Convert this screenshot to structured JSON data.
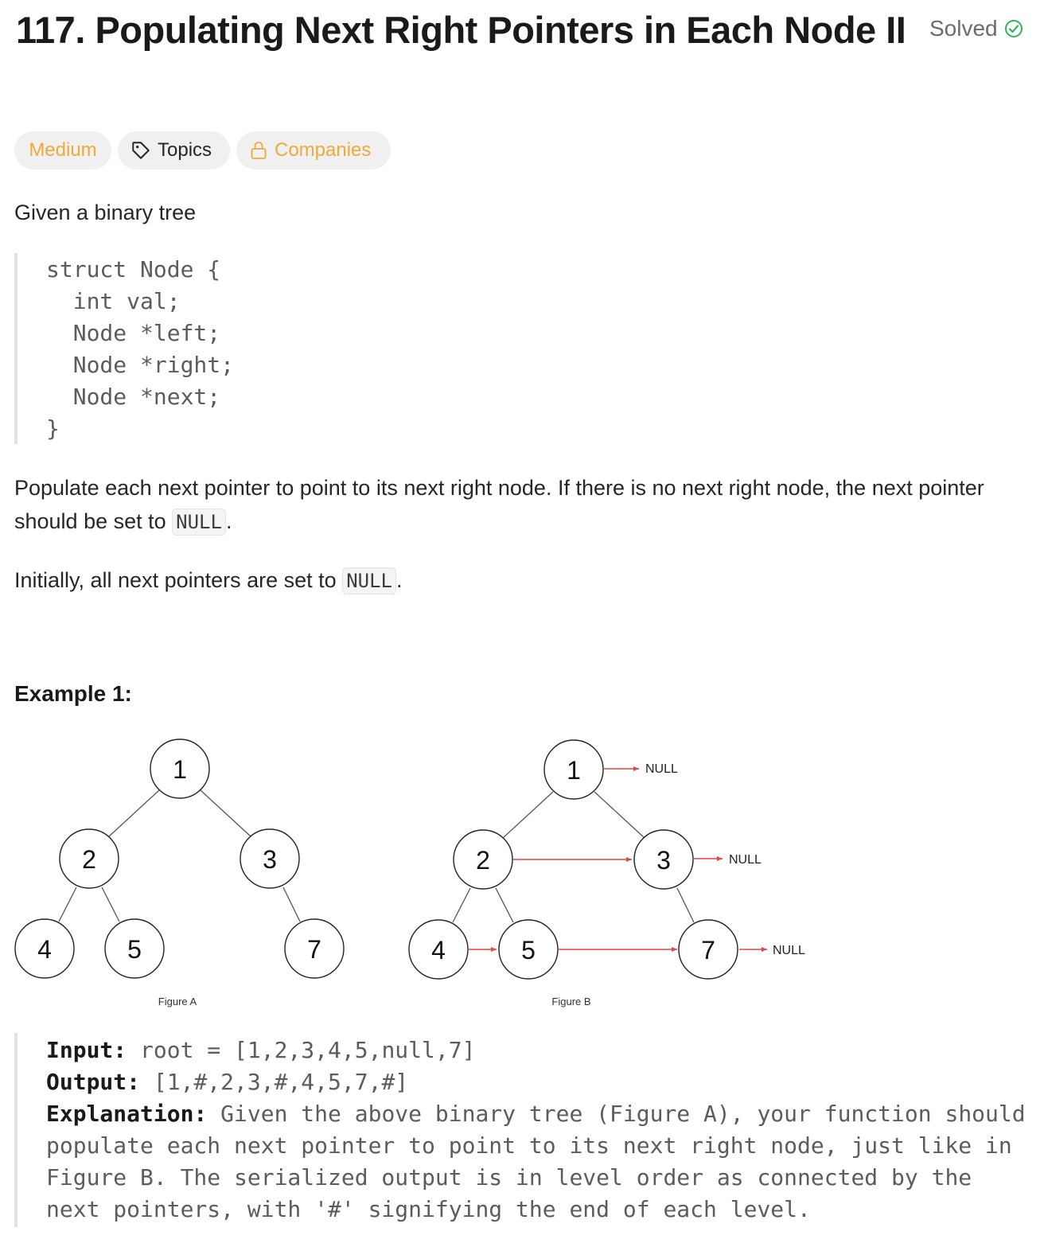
{
  "problem": {
    "title": "117. Populating Next Right Pointers in Each Node II",
    "status": "Solved",
    "status_icon": "check-circle-icon",
    "status_color": "#2db55d"
  },
  "tags": {
    "difficulty": "Medium",
    "difficulty_color": "#f0a93a",
    "topics_label": "Topics",
    "topics_icon": "tag-icon",
    "companies_label": "Companies",
    "companies_icon": "lock-icon"
  },
  "description": {
    "intro": "Given a binary tree",
    "struct_code": "struct Node {\n  int val;\n  Node *left;\n  Node *right;\n  Node *next;\n}",
    "p1_text": "Populate each next pointer to point to its next right node. If there is no next right node, the next pointer should be set to ",
    "p1_code": "NULL",
    "p1_end": ".",
    "p2_text": "Initially, all next pointers are set to ",
    "p2_code": "NULL",
    "p2_end": "."
  },
  "example1": {
    "heading": "Example 1:",
    "figure_a": {
      "caption": "Figure A",
      "nodes": [
        "1",
        "2",
        "3",
        "4",
        "5",
        "7"
      ]
    },
    "figure_b": {
      "caption": "Figure B",
      "nodes": [
        "1",
        "2",
        "3",
        "4",
        "5",
        "7"
      ],
      "null_labels": [
        "NULL",
        "NULL",
        "NULL"
      ]
    },
    "input_label": "Input:",
    "input_value": " root = [1,2,3,4,5,null,7]",
    "output_label": "Output:",
    "output_value": " [1,#,2,3,#,4,5,7,#]",
    "explanation_label": "Explanation:",
    "explanation_line1": " Given the above binary tree (Figure A), your function should",
    "explanation_line2": "populate each next pointer to point to its next right node, just like in",
    "explanation_line3": "Figure B. The serialized output is in level order as connected by the",
    "explanation_line4": "next pointers, with '#' signifying the end of each level."
  }
}
